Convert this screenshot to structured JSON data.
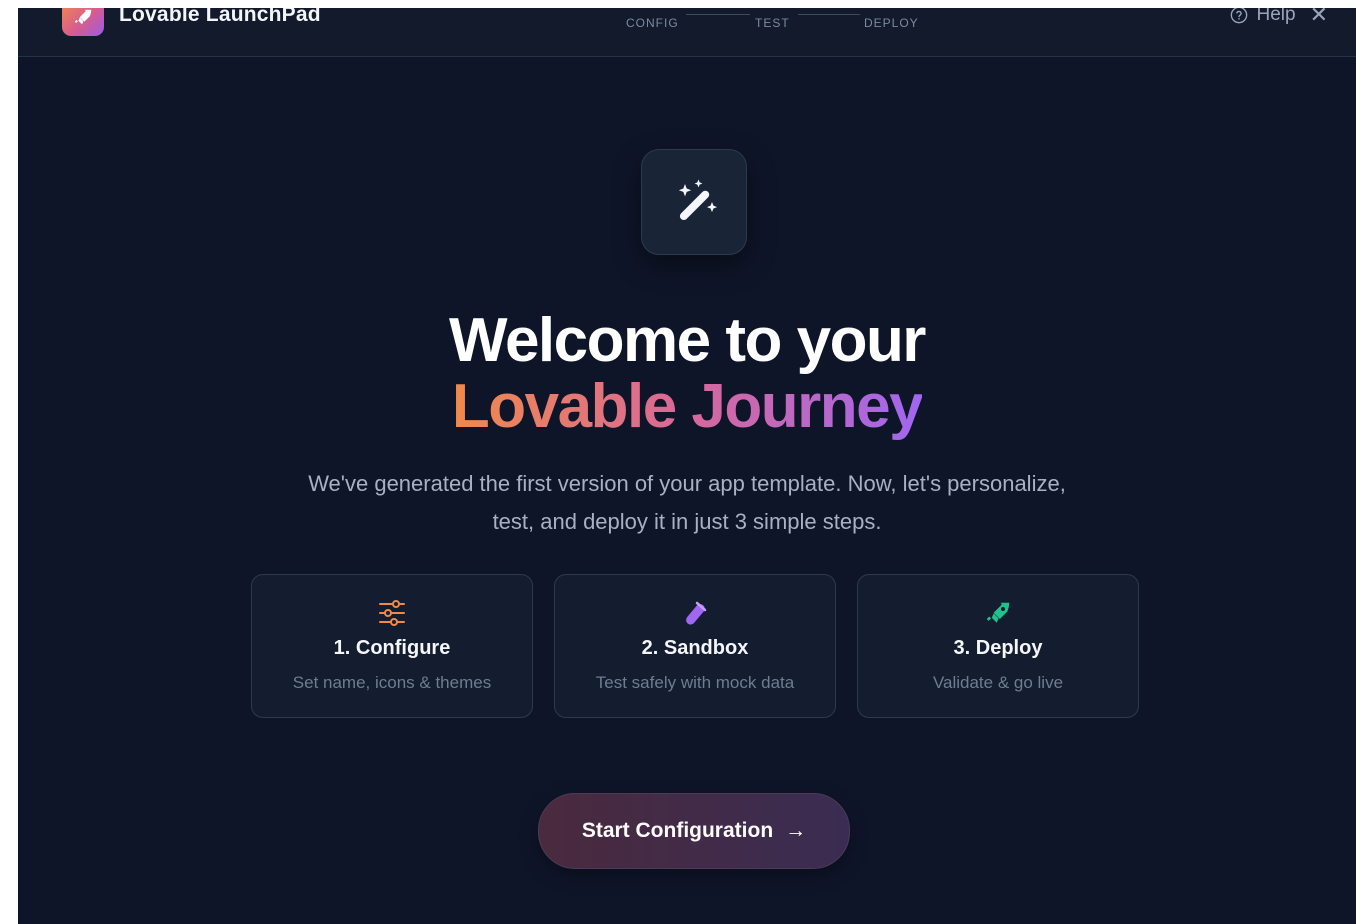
{
  "header": {
    "brand_name": "Lovable LaunchPad",
    "steps": [
      {
        "label": "CONFIG"
      },
      {
        "label": "TEST"
      },
      {
        "label": "DEPLOY"
      }
    ],
    "help_label": "Help",
    "close_label": "✕"
  },
  "main": {
    "title_line1": "Welcome to your",
    "title_line2": "Lovable Journey",
    "subtitle_line1": "We've generated the first version of your app template. Now, let's personalize,",
    "subtitle_line2": "test, and deploy it in just 3 simple steps.",
    "cards": [
      {
        "title": "1. Configure",
        "desc": "Set name, icons & themes",
        "icon": "sliders-icon",
        "color": "#f08a4b"
      },
      {
        "title": "2. Sandbox",
        "desc": "Test safely with mock data",
        "icon": "test-tube-icon",
        "color": "#a067f0"
      },
      {
        "title": "3. Deploy",
        "desc": "Validate & go live",
        "icon": "rocket-icon",
        "color": "#22c08a"
      }
    ],
    "cta_label": "Start Configuration",
    "cta_arrow": "→"
  },
  "colors": {
    "background": "#0f1529",
    "card_bg": "#141c2f",
    "accent_orange": "#f08a4b",
    "accent_purple": "#a067f0",
    "accent_green": "#22c08a"
  }
}
